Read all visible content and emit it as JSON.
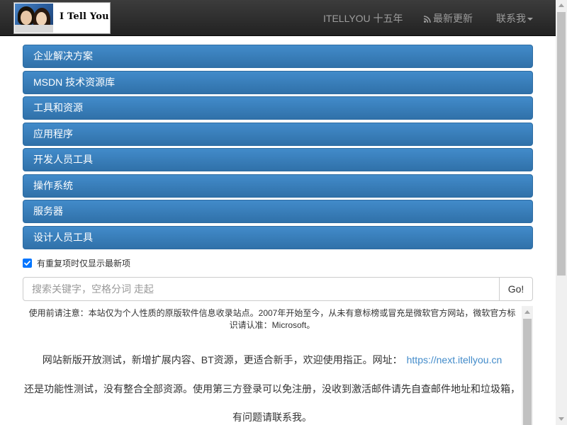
{
  "header": {
    "logo_text": "I Tell You",
    "nav": {
      "fifteen_years": "ITELLYOU 十五年",
      "latest_updates": "最新更新",
      "contact": "联系我"
    }
  },
  "accordion": {
    "items": [
      {
        "label": "企业解决方案"
      },
      {
        "label": "MSDN 技术资源库"
      },
      {
        "label": "工具和资源"
      },
      {
        "label": "应用程序"
      },
      {
        "label": "开发人员工具"
      },
      {
        "label": "操作系统"
      },
      {
        "label": "服务器"
      },
      {
        "label": "设计人员工具"
      }
    ]
  },
  "filter": {
    "checkbox_label": "有重复项时仅显示最新项",
    "checked": true
  },
  "search": {
    "placeholder": "搜索关键字，空格分词 走起",
    "button_label": "Go!"
  },
  "notice": {
    "disclaimer": "使用前请注意：本站仅为个人性质的原版软件信息收录站点。2007年开始至今，从未有意标榜或冒充是微软官方网站，微软官方标识请认准：Microsoft。",
    "line1_text": "网站新版开放测试，新增扩展内容、BT资源，更适合新手，欢迎使用指正。网址：",
    "line1_link": "https://next.itellyou.cn",
    "line2_text": "还是功能性测试，没有整合全部资源。使用第三方登录可以免注册，没收到激活邮件请先自查邮件地址和垃圾箱，",
    "line3_text": "有问题请联系我。"
  },
  "colors": {
    "navbar": "#222222",
    "accordion": "#428bca",
    "link": "#428bca"
  }
}
